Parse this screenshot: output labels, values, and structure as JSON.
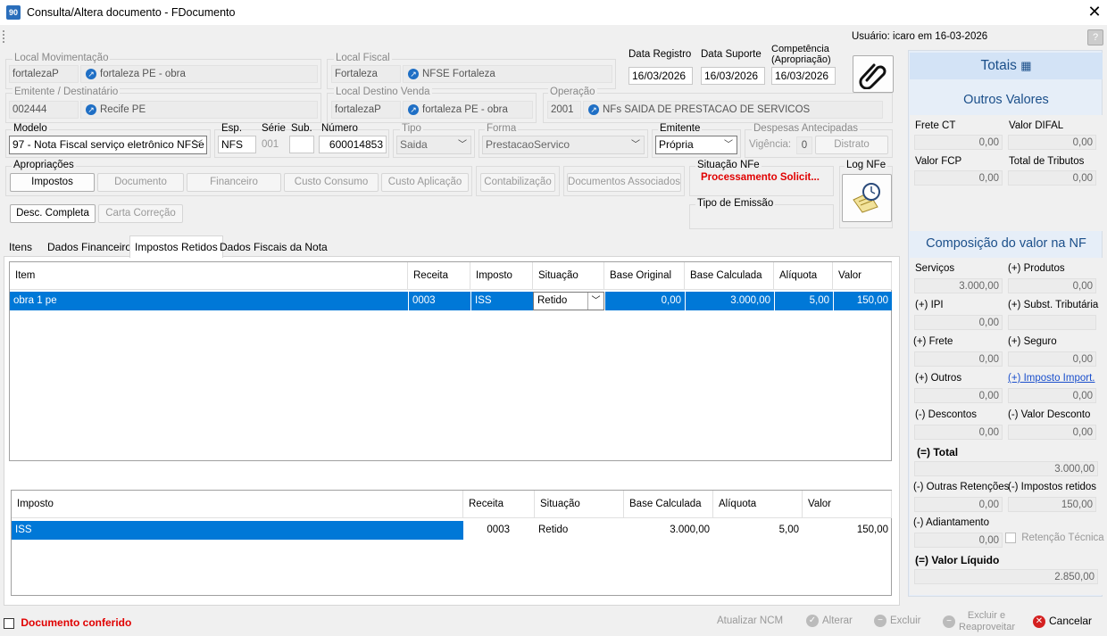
{
  "window": {
    "title": "Consulta/Altera documento - FDocumento",
    "app_icon": "90",
    "close": "✕"
  },
  "toolbar": {
    "user_text": "Usuário: icaro em 16-03-2026",
    "help": "?"
  },
  "local_movimentacao": {
    "label": "Local Movimentação",
    "code": "fortalezaP",
    "name": "fortaleza PE - obra"
  },
  "local_fiscal": {
    "label": "Local Fiscal",
    "code": "Fortaleza",
    "name": "NFSE Fortaleza"
  },
  "emitente": {
    "label": "Emitente / Destinatário",
    "code": "002444",
    "name": "Recife PE"
  },
  "local_destino": {
    "label": "Local Destino Venda",
    "code": "fortalezaP",
    "name": "fortaleza PE - obra"
  },
  "operacao": {
    "label": "Operação",
    "code": "2001",
    "name": "NFs SAIDA DE PRESTACAO DE SERVICOS"
  },
  "dates": {
    "registro_label": "Data Registro",
    "registro": "16/03/2026",
    "suporte_label": "Data Suporte",
    "suporte": "16/03/2026",
    "competencia_label": "Competência (Apropriação)",
    "competencia": "16/03/2026"
  },
  "modelo": {
    "label": "Modelo",
    "value": "97 - Nota Fiscal serviço eletrônico NFSe"
  },
  "esp": {
    "label": "Esp.",
    "value": "NFS"
  },
  "serie": {
    "label": "Série",
    "value": "001"
  },
  "sub": {
    "label": "Sub.",
    "value": ""
  },
  "numero": {
    "label": "Número",
    "value": "600014853"
  },
  "tipo": {
    "label": "Tipo",
    "value": "Saida"
  },
  "forma": {
    "label": "Forma",
    "value": "PrestacaoServico"
  },
  "emitente_sel": {
    "label": "Emitente",
    "value": "Própria"
  },
  "despesas": {
    "label": "Despesas Antecipadas",
    "vigencia_label": "Vigência:",
    "vigencia_value": "0",
    "distrato": "Distrato"
  },
  "apropriacoes": {
    "label": "Apropriações",
    "buttons": [
      "Impostos",
      "Documento",
      "Financeiro",
      "Custo Consumo",
      "Custo Aplicação"
    ],
    "contabilizacao": "Contabilização",
    "documentos_associados": "Documentos Associados",
    "desc_completa": "Desc. Completa",
    "carta_correcao": "Carta Correção"
  },
  "situacao_nfe": {
    "label": "Situação NFe",
    "value": "Processamento Solicit...",
    "value_color": "#e00000"
  },
  "tipo_emissao": {
    "label": "Tipo de Emissão"
  },
  "log_nfe": {
    "label": "Log NFe"
  },
  "tabs": [
    "Itens",
    "Dados Financeiros",
    "Impostos Retidos",
    "Dados Fiscais da Nota"
  ],
  "grid1": {
    "headers": [
      "Item",
      "Receita",
      "Imposto",
      "Situação",
      "Base Original",
      "Base Calculada",
      "Alíquota",
      "Valor"
    ],
    "rows": [
      {
        "item": "obra 1 pe",
        "receita": "0003",
        "imposto": "ISS",
        "situacao": "Retido",
        "base_original": "0,00",
        "base_calculada": "3.000,00",
        "aliquota": "5,00",
        "valor": "150,00"
      }
    ]
  },
  "grid2": {
    "headers": [
      "Imposto",
      "Receita",
      "Situação",
      "Base Calculada",
      "Alíquota",
      "Valor"
    ],
    "rows": [
      {
        "imposto": "ISS",
        "receita": "0003",
        "situacao": "Retido",
        "base_calculada": "3.000,00",
        "aliquota": "5,00",
        "valor": "150,00"
      }
    ]
  },
  "totais": {
    "title": "Totais",
    "outros_valores": "Outros Valores",
    "frete_ct_label": "Frete CT",
    "frete_ct": "0,00",
    "valor_difal_label": "Valor DIFAL",
    "valor_difal": "0,00",
    "valor_fcp_label": "Valor FCP",
    "valor_fcp": "0,00",
    "total_tributos_label": "Total de Tributos",
    "total_tributos": "0,00",
    "composicao": "Composição do valor na NF",
    "servicos_label": "Serviços",
    "servicos": "3.000,00",
    "produtos_label": "(+) Produtos",
    "produtos": "0,00",
    "ipi_label": "(+) IPI",
    "ipi": "0,00",
    "subst_label": "(+) Subst. Tributária",
    "subst": "",
    "frete_label": "(+) Frete",
    "frete": "0,00",
    "seguro_label": "(+) Seguro",
    "seguro": "0,00",
    "outros_label": "(+) Outros",
    "outros": "0,00",
    "imposto_import_label": "(+) Imposto Import.",
    "imposto_import": "0,00",
    "descontos_label": "(-) Descontos",
    "descontos": "0,00",
    "valor_desconto_label": "(-) Valor Desconto",
    "valor_desconto": "0,00",
    "total_label": "(=) Total",
    "total": "3.000,00",
    "outras_retencoes_label": "(-) Outras Retenções",
    "outras_retencoes": "0,00",
    "impostos_retidos_label": "(-) Impostos retidos",
    "impostos_retidos": "150,00",
    "adiantamento_label": "(-) Adiantamento",
    "adiantamento": "0,00",
    "retencao_tecnica_label": "Retenção Técnica",
    "valor_liquido_label": "(=) Valor Líquido",
    "valor_liquido": "2.850,00"
  },
  "footer": {
    "documento_conferido": "Documento conferido",
    "atualizar_ncm": "Atualizar NCM",
    "alterar": "Alterar",
    "excluir": "Excluir",
    "excluir_reaproveitar": "Excluir e Reaproveitar",
    "cancelar": "Cancelar"
  }
}
